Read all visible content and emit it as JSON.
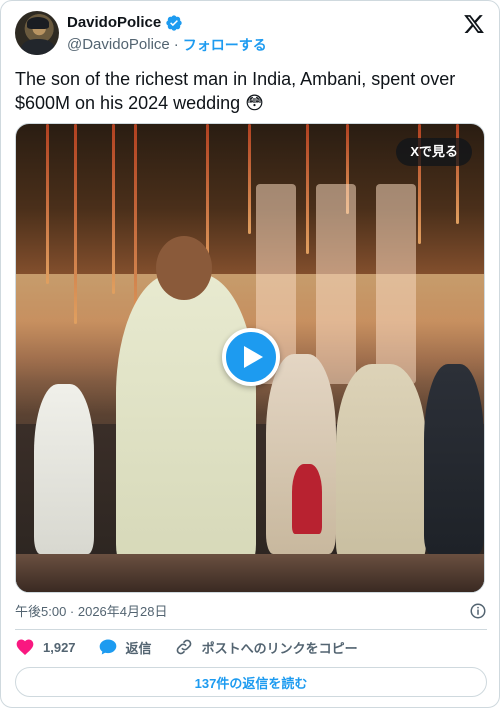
{
  "author": {
    "display_name": "DavidoPolice",
    "handle": "@DavidoPolice",
    "separator": "·",
    "follow_label": "フォローする"
  },
  "tweet": {
    "text": "The son of the richest man in India, Ambani, spent over $600M on his 2024 wedding 😳"
  },
  "media": {
    "watch_label": "Xで見る"
  },
  "meta": {
    "timestamp": "午後5:00 · 2026年4月28日"
  },
  "actions": {
    "like_count": "1,927",
    "reply_label": "返信",
    "copy_link_label": "ポストへのリンクをコピー"
  },
  "footer": {
    "read_replies_label": "137件の返信を読む"
  },
  "colors": {
    "accent": "#1d9bf0",
    "like": "#f91880",
    "text_secondary": "#536471"
  },
  "icons": [
    "verified-badge-icon",
    "x-logo-icon",
    "play-icon",
    "info-icon",
    "heart-icon",
    "reply-icon",
    "link-icon"
  ]
}
